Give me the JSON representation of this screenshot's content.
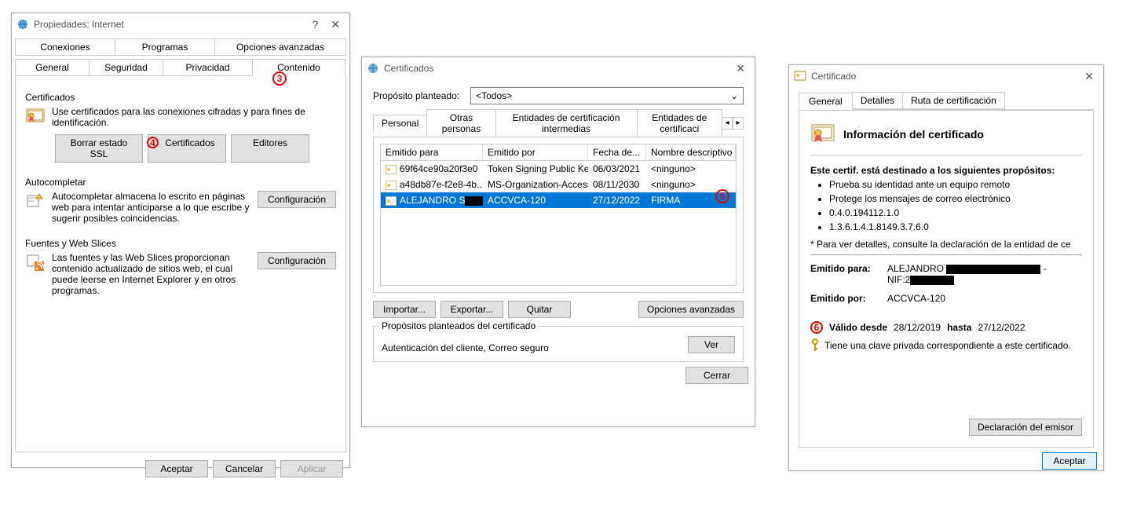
{
  "markers": {
    "m3": "3",
    "m4": "4",
    "m5": "5",
    "m6": "6"
  },
  "dlg1": {
    "title": "Propiedades: Internet",
    "help_glyph": "?",
    "close_glyph": "✕",
    "tabs_row1": [
      "Conexiones",
      "Programas",
      "Opciones avanzadas"
    ],
    "tabs_row2": [
      "General",
      "Seguridad",
      "Privacidad",
      "Contenido"
    ],
    "cert_group": "Certificados",
    "cert_desc": "Use certificados para las conexiones cifradas y para fines de identificación.",
    "btn_ssl": "Borrar estado SSL",
    "btn_certs": "Certificados",
    "btn_editors": "Editores",
    "ac_group": "Autocompletar",
    "ac_desc": "Autocompletar almacena lo escrito en páginas web para intentar anticiparse a lo que escribe y sugerir posibles coincidencias.",
    "btn_cfg": "Configuración",
    "feed_group": "Fuentes y Web Slices",
    "feed_desc": "Las fuentes y las Web Slices proporcionan contenido actualizado de sitios web, el cual puede leerse en Internet Explorer y en otros programas.",
    "foot_ok": "Aceptar",
    "foot_cancel": "Cancelar",
    "foot_apply": "Aplicar"
  },
  "dlg2": {
    "title": "Certificados",
    "close_glyph": "✕",
    "purpose_label": "Propósito planteado:",
    "purpose_value": "<Todos>",
    "tabs": [
      "Personal",
      "Otras personas",
      "Entidades de certificación intermedias",
      "Entidades de certificaci"
    ],
    "nav_left": "◂",
    "nav_right": "▸",
    "hdr": [
      "Emitido para",
      "Emitido por",
      "Fecha de...",
      "Nombre descriptivo"
    ],
    "rows": [
      {
        "c1": "69f64ce90a20f3e0",
        "c2": "Token Signing Public Key",
        "c3": "06/03/2021",
        "c4": "<ninguno>",
        "sel": false
      },
      {
        "c1": "a48db87e-f2e8-4b...",
        "c2": "MS-Organization-Access",
        "c3": "08/11/2030",
        "c4": "<ninguno>",
        "sel": false
      },
      {
        "c1": "ALEJANDRO S",
        "c2": "ACCVCA-120",
        "c3": "27/12/2022",
        "c4": "FIRMA",
        "sel": true
      }
    ],
    "btn_import": "Importar...",
    "btn_export": "Exportar...",
    "btn_remove": "Quitar",
    "btn_adv": "Opciones avanzadas",
    "purposes_legend": "Propósitos planteados del certificado",
    "purposes_text": "Autenticación del cliente, Correo seguro",
    "btn_view": "Ver",
    "btn_close": "Cerrar"
  },
  "dlg3": {
    "title": "Certificado",
    "close_glyph": "✕",
    "tabs": [
      "General",
      "Detalles",
      "Ruta de certificación"
    ],
    "header": "Información del certificado",
    "intro": "Este certif. está destinado a los siguientes propósitos:",
    "bullets": [
      "Prueba su identidad ante un equipo remoto",
      "Protege los mensajes de correo electrónico",
      "0.4.0.194112.1.0",
      "1.3.6.1.4.1.8149.3.7.6.0"
    ],
    "note": "* Para ver detalles, consulte la declaración de la entidad de ce",
    "issued_to_label": "Emitido para:",
    "issued_to_value_part1": "ALEJANDRO ",
    "issued_to_line2a": "NIF:2",
    "issued_by_label": "Emitido por:",
    "issued_by_value": "ACCVCA-120",
    "valid_from_label": "Válido desde",
    "valid_from": "28/12/2019",
    "valid_to_label": "hasta",
    "valid_to": "27/12/2022",
    "priv_key": "Tiene una clave privada correspondiente a este certificado.",
    "btn_issuer": "Declaración del emisor",
    "btn_ok": "Aceptar"
  }
}
